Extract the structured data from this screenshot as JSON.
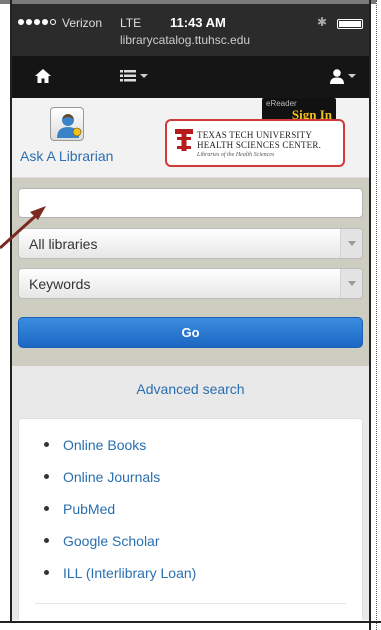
{
  "status_bar": {
    "carrier": "Verizon",
    "network": "LTE",
    "time": "11:43 AM",
    "url": "librarycatalog.ttuhsc.edu"
  },
  "nav": {
    "home_icon": "home-icon",
    "menu_icon": "list-icon",
    "user_icon": "user-icon"
  },
  "header": {
    "ask_librarian": "Ask A Librarian",
    "ezproxy_small": "eReader",
    "sign_in": "Sign In",
    "logo_line1": "TEXAS TECH UNIVERSITY",
    "logo_line2": "HEALTH SCIENCES CENTER.",
    "logo_line3": "Libraries of the Health Sciences"
  },
  "search": {
    "input_value": "",
    "library_select": "All libraries",
    "field_select": "Keywords",
    "go_label": "Go",
    "advanced_link": "Advanced search"
  },
  "links": [
    {
      "label": "Online Books"
    },
    {
      "label": "Online Journals"
    },
    {
      "label": "PubMed"
    },
    {
      "label": "Google Scholar"
    },
    {
      "label": "ILL (Interlibrary Loan)"
    }
  ],
  "colors": {
    "link": "#2a6fb0",
    "go_button": "#1b67c2",
    "annotation_arrow": "#7b2a22",
    "logo_border": "#d23a3a",
    "sign_in": "#f2c21b"
  }
}
